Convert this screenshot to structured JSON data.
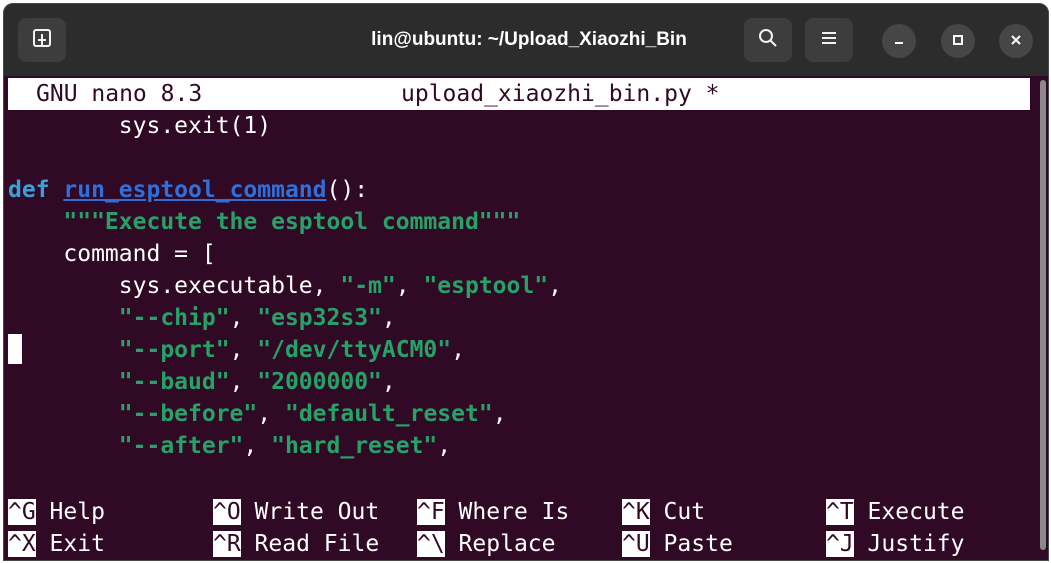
{
  "window": {
    "title": "lin@ubuntu: ~/Upload_Xiaozhi_Bin"
  },
  "titlebar_icons": {
    "new_tab": "new-tab-icon",
    "search": "search-icon",
    "menu": "hamburger-menu-icon",
    "minimize": "minimize-icon",
    "maximize": "maximize-icon",
    "close": "close-icon"
  },
  "nano": {
    "app": "GNU nano 8.3",
    "filename": "upload_xiaozhi_bin.py *"
  },
  "code": {
    "l1": "        sys.exit(1)",
    "l3_def": "def",
    "l3_fn": "run_esptool_command",
    "l3_rest": "():",
    "l4": "\"\"\"Execute the esptool command\"\"\"",
    "l5": "    command = [",
    "l6_a": "        sys.executable, ",
    "l6_b": "\"-m\"",
    "l6_c": ", ",
    "l6_d": "\"esptool\"",
    "l6_e": ",",
    "l7_a": "\"--chip\"",
    "l7_b": ", ",
    "l7_c": "\"esp32s3\"",
    "l7_d": ",",
    "l8_a": "\"--port\"",
    "l8_b": ", ",
    "l8_c": "\"/dev/ttyACM0\"",
    "l8_d": ",",
    "l9_a": "\"--baud\"",
    "l9_b": ", ",
    "l9_c": "\"2000000\"",
    "l9_d": ",",
    "l10_a": "\"--before\"",
    "l10_b": ", ",
    "l10_c": "\"default_reset\"",
    "l10_d": ",",
    "l11_a": "\"--after\"",
    "l11_b": ", ",
    "l11_c": "\"hard_reset\"",
    "l11_d": ","
  },
  "shortcuts": [
    {
      "key": "^G",
      "label": " Help"
    },
    {
      "key": "^O",
      "label": " Write Out"
    },
    {
      "key": "^F",
      "label": " Where Is"
    },
    {
      "key": "^K",
      "label": " Cut"
    },
    {
      "key": "^T",
      "label": " Execute"
    },
    {
      "key": "^X",
      "label": " Exit"
    },
    {
      "key": "^R",
      "label": " Read File"
    },
    {
      "key": "^\\",
      "label": " Replace"
    },
    {
      "key": "^U",
      "label": " Paste"
    },
    {
      "key": "^J",
      "label": " Justify"
    }
  ],
  "colors": {
    "terminal_bg": "#300a24",
    "keyword": "#3aa0d8",
    "function": "#2f6fdc",
    "string": "#26a269"
  }
}
